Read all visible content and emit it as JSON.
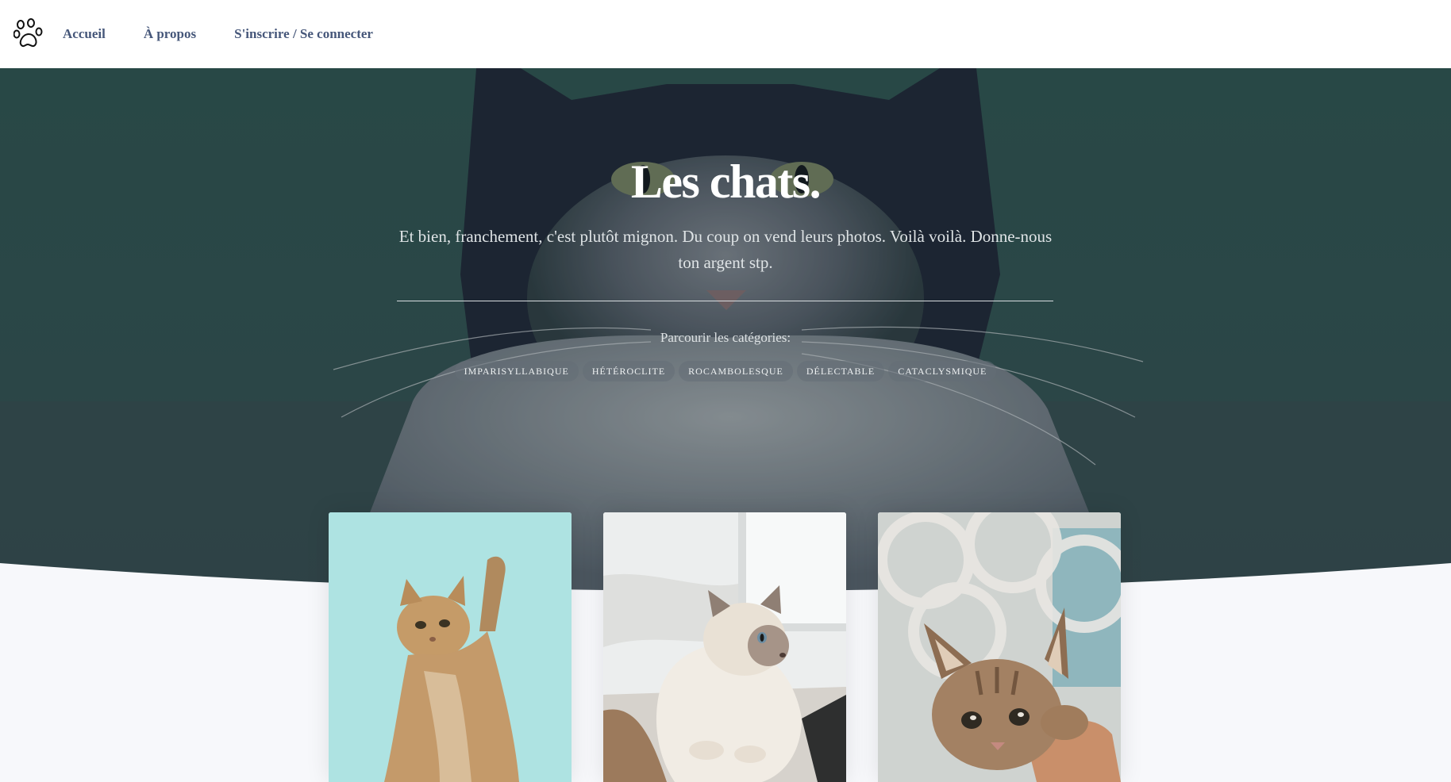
{
  "navbar": {
    "logo_icon": "paw-icon",
    "links": [
      {
        "label": "Accueil"
      },
      {
        "label": "À propos"
      },
      {
        "label": "S'inscrire / Se connecter"
      }
    ]
  },
  "hero": {
    "background_image": "cat-portrait-photo",
    "title": "Les chats.",
    "subtitle": "Et bien, franchement, c'est plutôt mignon. Du coup on vend leurs photos. Voilà voilà. Donne-nous ton argent stp.",
    "browse_label": "Parcourir les catégories:",
    "categories": [
      {
        "label": "Imparisyllabique"
      },
      {
        "label": "Hétéroclite"
      },
      {
        "label": "Rocambolesque"
      },
      {
        "label": "Délectable"
      },
      {
        "label": "Cataclysmique"
      }
    ]
  },
  "cards": [
    {
      "image": "kitten-reaching-up-photo"
    },
    {
      "image": "himalayan-cat-photo"
    },
    {
      "image": "tabby-kitten-photo"
    }
  ],
  "colors": {
    "nav_link": "#46577a",
    "hero_overlay": "#2f4a4a",
    "page_background": "#f7f8fb"
  }
}
